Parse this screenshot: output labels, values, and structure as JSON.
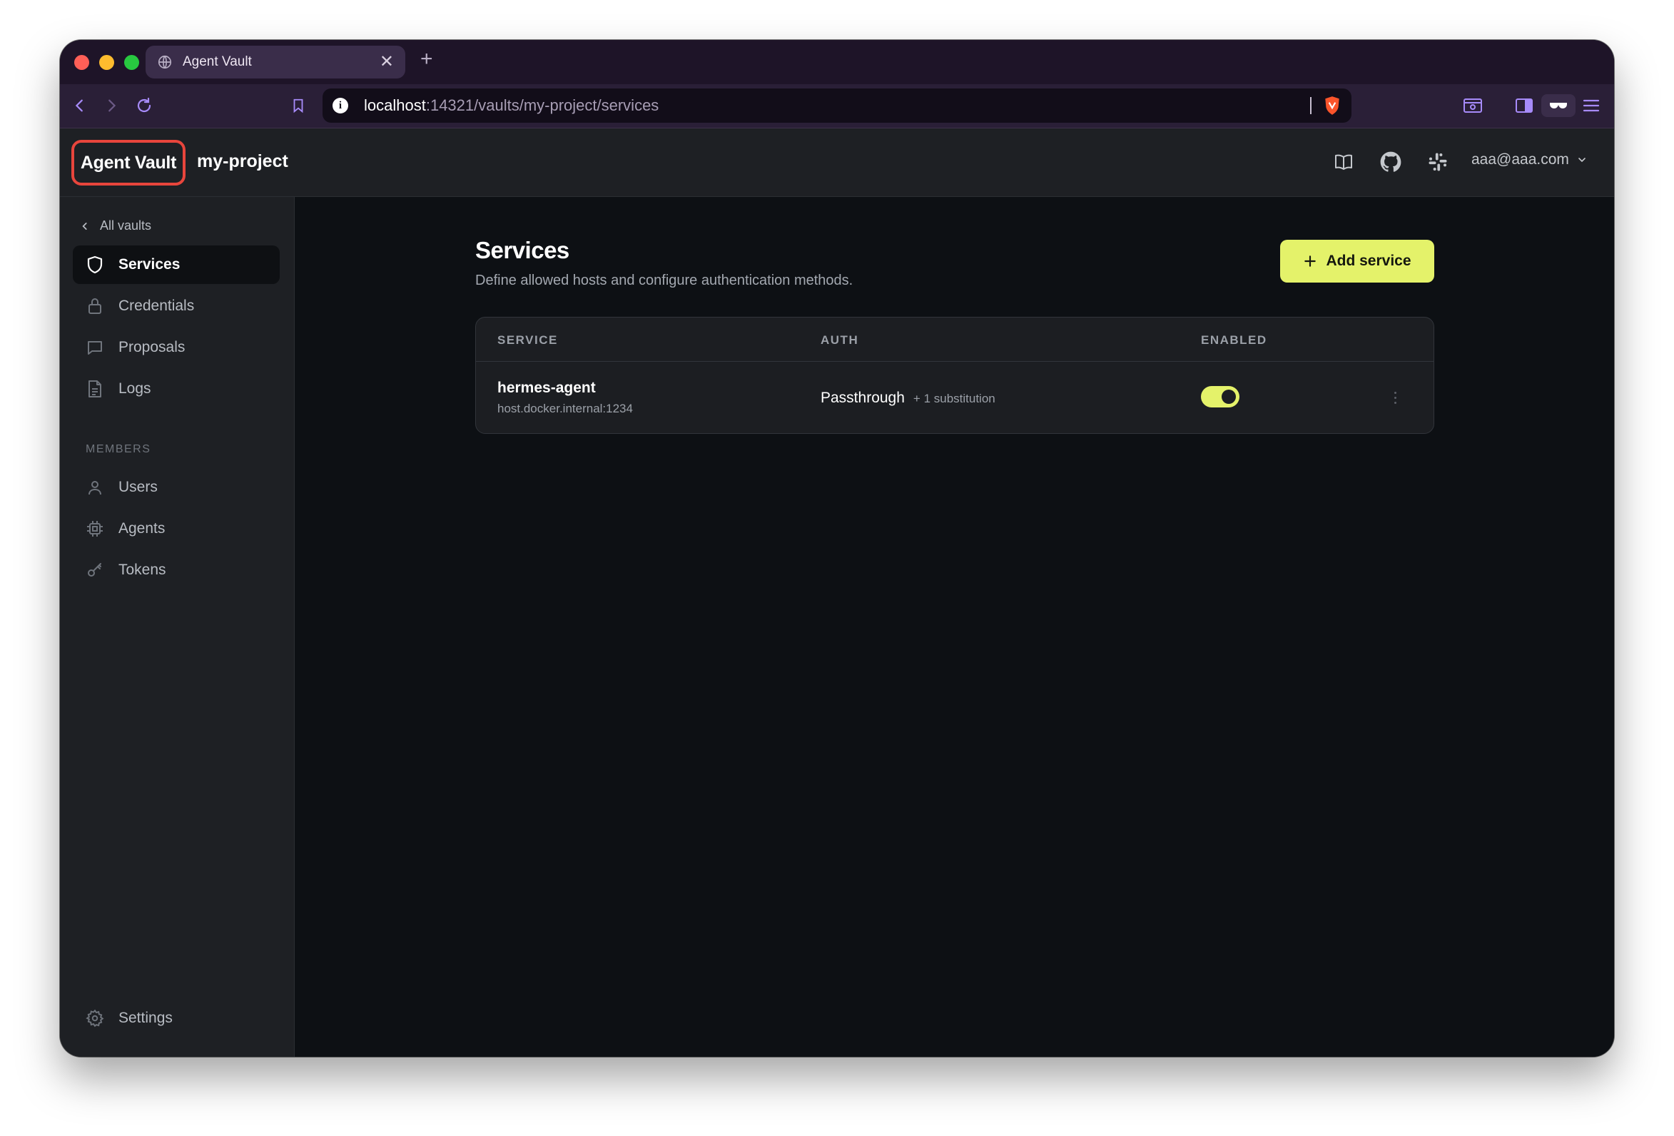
{
  "browser": {
    "tab_title": "Agent Vault",
    "new_tab": "+",
    "tab_close": "✕",
    "url_host": "localhost",
    "url_path": ":14321/vaults/my-project/services"
  },
  "header": {
    "logo": "Agent Vault",
    "project": "my-project",
    "user_email": "aaa@aaa.com"
  },
  "sidebar": {
    "back_link": "All vaults",
    "items": [
      {
        "label": "Services",
        "icon": "shield-icon",
        "active": true
      },
      {
        "label": "Credentials",
        "icon": "lock-icon"
      },
      {
        "label": "Proposals",
        "icon": "message-icon"
      },
      {
        "label": "Logs",
        "icon": "document-icon"
      }
    ],
    "members_label": "MEMBERS",
    "member_items": [
      {
        "label": "Users",
        "icon": "user-icon"
      },
      {
        "label": "Agents",
        "icon": "chip-icon"
      },
      {
        "label": "Tokens",
        "icon": "key-icon"
      }
    ],
    "settings_label": "Settings"
  },
  "main": {
    "title": "Services",
    "subtitle": "Define allowed hosts and configure authentication methods.",
    "add_button": "Add service",
    "table": {
      "columns": [
        "SERVICE",
        "AUTH",
        "ENABLED"
      ],
      "rows": [
        {
          "name": "hermes-agent",
          "host": "host.docker.internal:1234",
          "auth": "Passthrough",
          "auth_extra": "+ 1 substitution",
          "enabled": true
        }
      ]
    }
  },
  "colors": {
    "accent": "#e4f26a",
    "logo_outline": "#e8453c",
    "background": "#0d1014",
    "sidebar": "#1e2024"
  }
}
